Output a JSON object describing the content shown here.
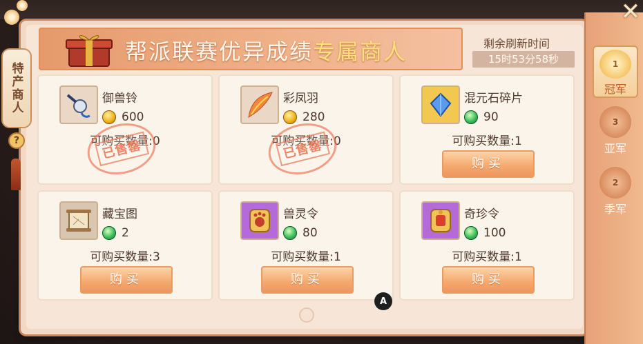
{
  "side_tab": {
    "label": "特产商人"
  },
  "help": {
    "label": "?"
  },
  "banner": {
    "title_prefix": "帮派联赛优异成绩",
    "title_highlight": "专属商人"
  },
  "refresh": {
    "label": "剩余刷新时间",
    "time": "15时53分58秒"
  },
  "cards": [
    {
      "name": "御兽铃",
      "currency": "gold",
      "price": "600",
      "qty": "可购买数量:0",
      "sold": true
    },
    {
      "name": "彩凤羽",
      "currency": "gold",
      "price": "280",
      "qty": "可购买数量:0",
      "sold": true
    },
    {
      "name": "混元石碎片",
      "currency": "jade",
      "price": "90",
      "qty": "可购买数量:1",
      "sold": false
    },
    {
      "name": "藏宝图",
      "currency": "jade",
      "price": "2",
      "qty": "可购买数量:3",
      "sold": false
    },
    {
      "name": "兽灵令",
      "currency": "jade",
      "price": "80",
      "qty": "可购买数量:1",
      "sold": false
    },
    {
      "name": "奇珍令",
      "currency": "jade",
      "price": "100",
      "qty": "可购买数量:1",
      "sold": false
    }
  ],
  "buy_label": "购买",
  "sold_label": "已售罄",
  "badge": "A",
  "ranks": [
    {
      "label": "冠军",
      "number": "1",
      "active": true
    },
    {
      "label": "亚军",
      "number": "3",
      "active": false
    },
    {
      "label": "季军",
      "number": "2",
      "active": false
    }
  ],
  "colors": {
    "accent": "#ef9660",
    "highlight": "#ffe07a",
    "panel": "#f7e6d8"
  }
}
